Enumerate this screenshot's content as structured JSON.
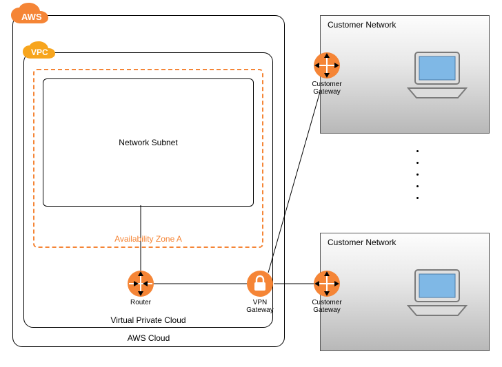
{
  "aws_cloud": {
    "badge": "AWS",
    "label": "AWS Cloud"
  },
  "vpc": {
    "badge": "VPC",
    "label": "Virtual Private Cloud"
  },
  "az": {
    "label": "Availability Zone A"
  },
  "subnet": {
    "label": "Network Subnet"
  },
  "router": {
    "label": "Router"
  },
  "vpn_gateway": {
    "label": "VPN\nGateway"
  },
  "customer_networks": {
    "top": {
      "title": "Customer Network",
      "gateway_label": "Customer\nGateway"
    },
    "bottom": {
      "title": "Customer Network",
      "gateway_label": "Customer\nGateway"
    }
  },
  "colors": {
    "orange": "#f58536",
    "badge_yellow": "#f7a51d"
  }
}
